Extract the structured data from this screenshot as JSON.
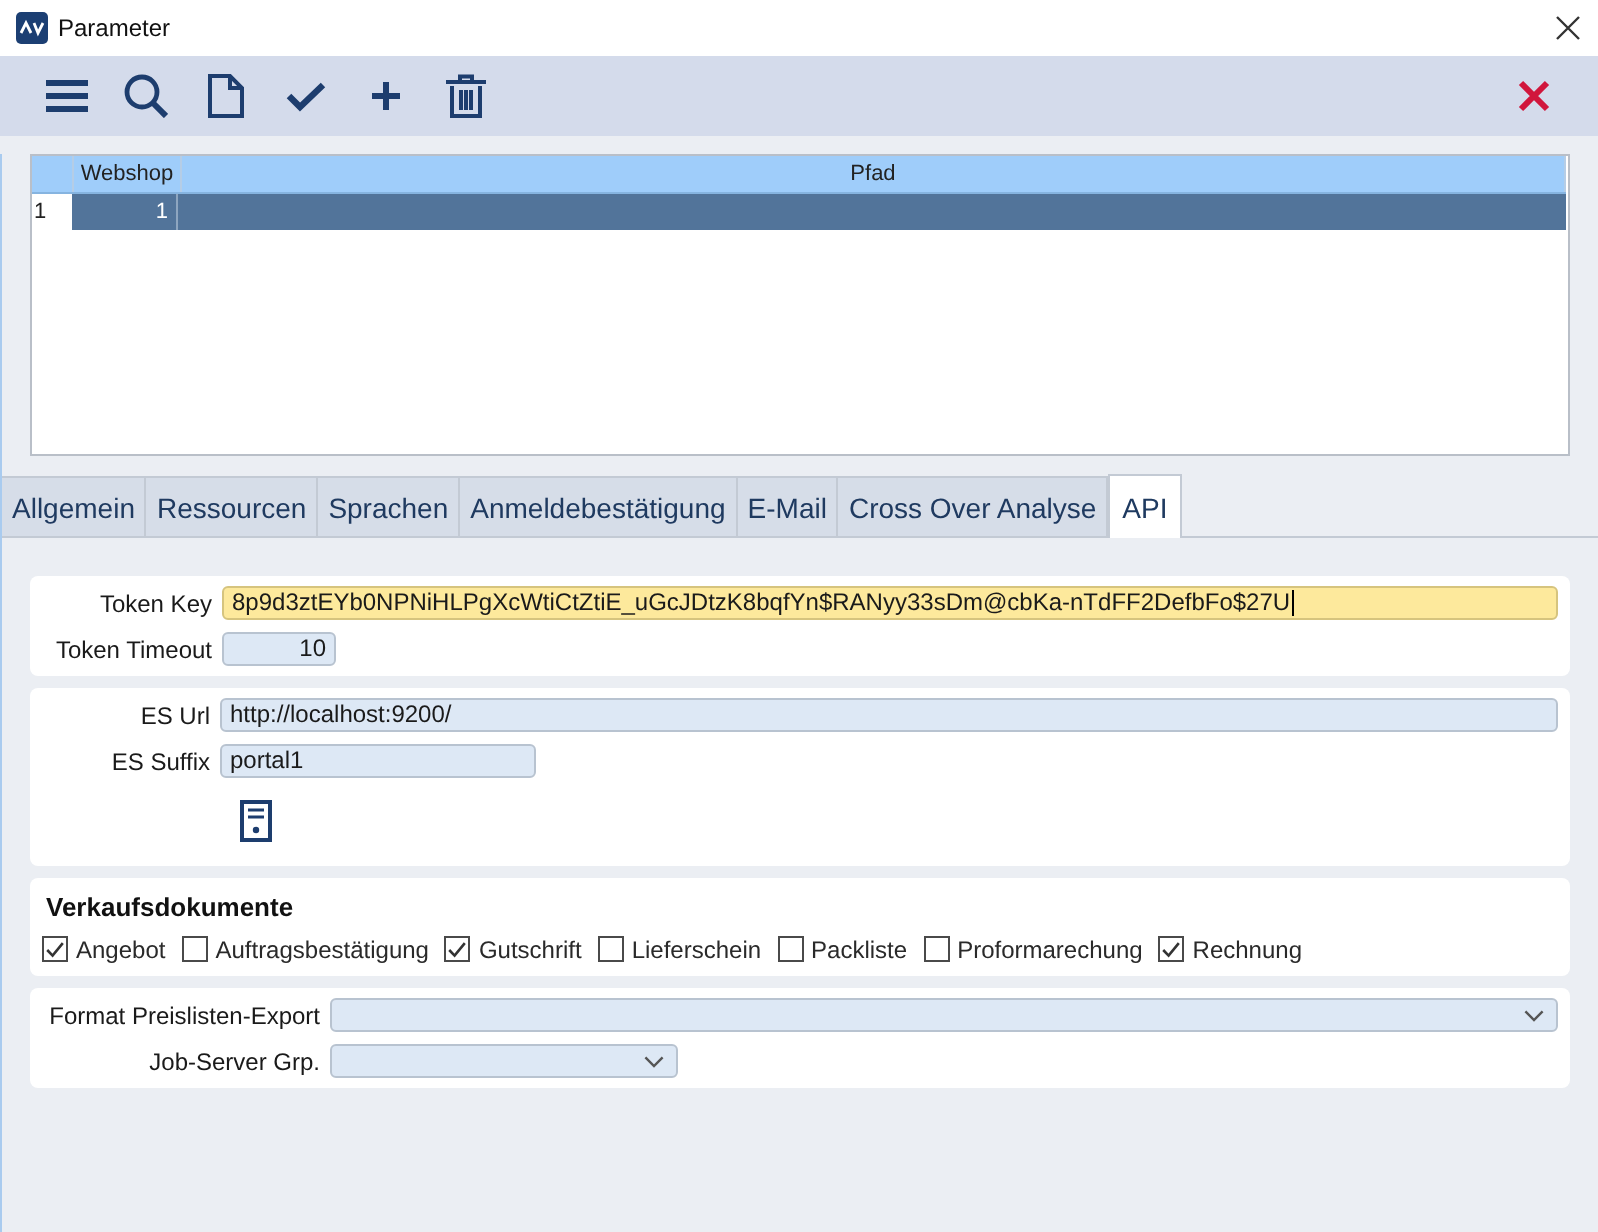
{
  "window": {
    "title": "Parameter"
  },
  "table": {
    "columns": [
      "Webshop",
      "Pfad"
    ],
    "rows": [
      {
        "number": "1",
        "selected": true,
        "cells": [
          "1"
        ]
      }
    ]
  },
  "tabs": [
    {
      "label": "Allgemein",
      "selected": false
    },
    {
      "label": "Ressourcen",
      "selected": false
    },
    {
      "label": "Sprachen",
      "selected": false
    },
    {
      "label": "Anmeldebestätigung",
      "selected": false
    },
    {
      "label": "E-Mail",
      "selected": false
    },
    {
      "label": "Cross Over Analyse",
      "selected": false
    },
    {
      "label": "API",
      "selected": true
    }
  ],
  "token": {
    "fields": [
      {
        "kind": "text",
        "label": "Token Key",
        "value": "8p9d3ztEYb0NPNiHLPgXcWtiCtZtiE_uGcJDtzK8bqfYn$RANyy33sDm@cbKa-nTdFF2DefbFo$27U",
        "focused": true
      },
      {
        "kind": "number",
        "label": "Token Timeout",
        "value": "10",
        "focused": false
      }
    ]
  },
  "search_server": {
    "fields": [
      {
        "kind": "text",
        "label": "ES Url",
        "value": "http://localhost:9200/",
        "focused": false
      },
      {
        "kind": "text",
        "label": "ES Suffix",
        "value": "portal1",
        "focused": false
      }
    ]
  },
  "sales_documents": {
    "title": "Verkaufsdokumente",
    "options": [
      {
        "label": "Angebot",
        "checked": true
      },
      {
        "label": "Auftragsbestätigung",
        "checked": false
      },
      {
        "label": "Gutschrift",
        "checked": true
      },
      {
        "label": "Lieferschein",
        "checked": false
      },
      {
        "label": "Packliste",
        "checked": false
      },
      {
        "label": "Proformarechung",
        "checked": false
      },
      {
        "label": "Rechnung",
        "checked": true
      }
    ]
  },
  "export": {
    "fields": [
      {
        "kind": "dropdown",
        "label": "Format Preislisten-Export",
        "focused": false
      },
      {
        "kind": "dropdown",
        "label": "Job-Server Grp.",
        "focused": false
      }
    ]
  }
}
